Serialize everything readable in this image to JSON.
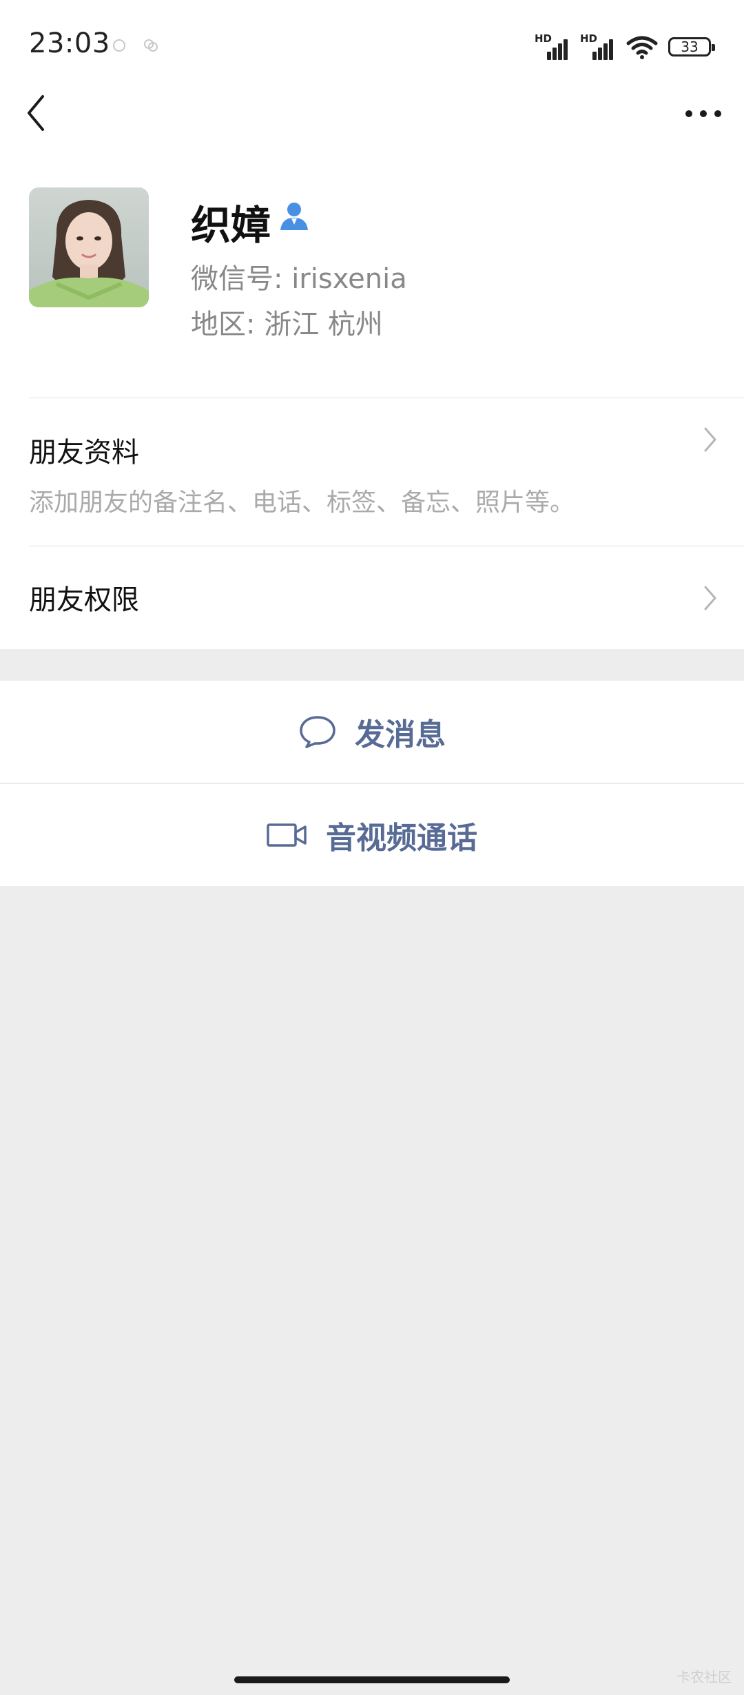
{
  "status_bar": {
    "time": "23:03",
    "hd1": "HD",
    "hd2": "HD",
    "battery": "33"
  },
  "nav": {
    "back_icon": "chevron-left-icon",
    "more_icon": "more-dots-icon"
  },
  "profile": {
    "name": "织嫜",
    "wechat_id": "微信号: irisxenia",
    "region": "地区: 浙江  杭州",
    "verify_icon": "person-icon",
    "verify_color": "#4a90e2"
  },
  "friend_info": {
    "title": "朋友资料",
    "subtitle": "添加朋友的备注名、电话、标签、备忘、照片等。"
  },
  "friend_permissions": {
    "title": "朋友权限"
  },
  "actions": {
    "message_label": "发消息",
    "call_label": "音视频通话",
    "accent": "#576b95"
  },
  "watermark": "卡农社区"
}
